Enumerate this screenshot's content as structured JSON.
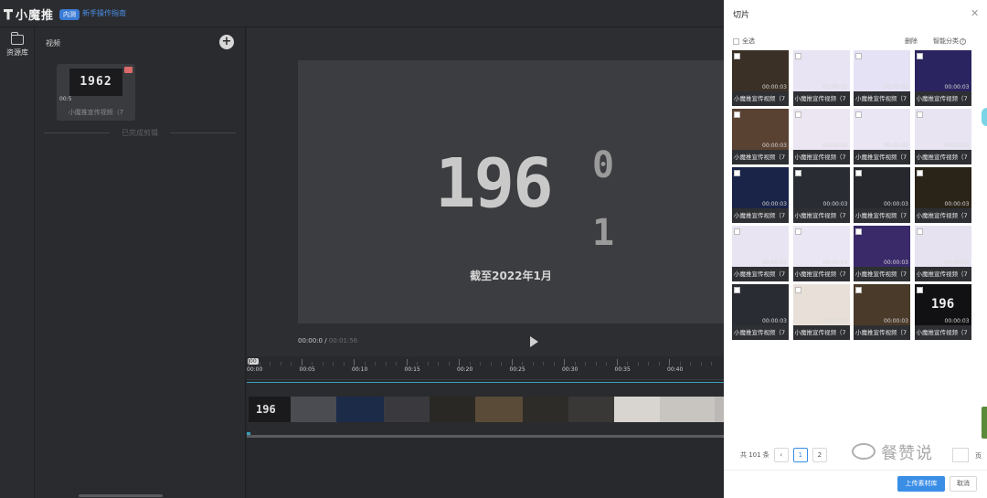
{
  "app": {
    "name": "小魔推",
    "badge": "内测",
    "guide_link": "新手操作指南"
  },
  "rail": {
    "items": [
      {
        "label": "资源库",
        "icon": "folder-icon"
      }
    ]
  },
  "resource_panel": {
    "title": "视频",
    "add_icon": "plus-icon",
    "card": {
      "thumb_text": "1962",
      "duration": "00:5",
      "name": "小魔推宣传视频（7"
    },
    "divider": "已完成剪辑"
  },
  "preview": {
    "big_number": "196",
    "roll_top": "0",
    "roll_bottom": "1",
    "caption": "截至2022年1月",
    "current_time": "00:00:0",
    "separator": " / ",
    "total_time": "00:01:56",
    "play_icon": "play-icon"
  },
  "timeline": {
    "playhead": "00",
    "ticks": [
      "00:00",
      "00:05",
      "00:10",
      "00:15",
      "00:20",
      "00:25",
      "00:30",
      "00:35",
      "00:40"
    ],
    "strip_colors": [
      "#1a1a1c",
      "#4a4c52",
      "#1c2b48",
      "#3a3a3e",
      "#2a2824",
      "#5a4a38",
      "#2e2c28",
      "#3a3836",
      "#d8d4d0",
      "#c8c4c0",
      "#bcb8b6"
    ],
    "strip_label": "196"
  },
  "panel": {
    "title": "切片",
    "close_icon": "close-icon",
    "select_all": "全选",
    "delete": "删除",
    "smart_sort": "智能分类",
    "help_icon": "question-icon",
    "clips": [
      {
        "name": "小魔推宣传视频（7",
        "duration": "00:00:03",
        "thumb": "#3a3026"
      },
      {
        "name": "小魔推宣传视频（7",
        "duration": "00:00:02",
        "thumb": "#e8e4f4"
      },
      {
        "name": "小魔推宣传视频（7",
        "duration": "00:00:02",
        "thumb": "#e6e2f6"
      },
      {
        "name": "小魔推宣传视频（7",
        "duration": "00:00:03",
        "thumb": "#2a2460"
      },
      {
        "name": "小魔推宣传视频（7",
        "duration": "00:00:03",
        "thumb": "#5a4232"
      },
      {
        "name": "小魔推宣传视频（7",
        "duration": "00:00:02",
        "thumb": "#ece6f2"
      },
      {
        "name": "小魔推宣传视频（7",
        "duration": "00:00:02",
        "thumb": "#eae6f4"
      },
      {
        "name": "小魔推宣传视频（7",
        "duration": "00:00:03",
        "thumb": "#e8e4f2"
      },
      {
        "name": "小魔推宣传视频（7",
        "duration": "00:00:03",
        "thumb": "#1a2448"
      },
      {
        "name": "小魔推宣传视频（7",
        "duration": "00:00:03",
        "thumb": "#2a2c34"
      },
      {
        "name": "小魔推宣传视频（7",
        "duration": "00:00:03",
        "thumb": "#26282e"
      },
      {
        "name": "小魔推宣传视频（7",
        "duration": "00:00:03",
        "thumb": "#2a2418"
      },
      {
        "name": "小魔推宣传视频（7",
        "duration": "00:00:03",
        "thumb": "#e8e4f2"
      },
      {
        "name": "小魔推宣传视频（7",
        "duration": "00:00:03",
        "thumb": "#eae6f4"
      },
      {
        "name": "小魔推宣传视频（7",
        "duration": "00:00:03",
        "thumb": "#3a2a6a"
      },
      {
        "name": "小魔推宣传视频（7",
        "duration": "00:00:03",
        "thumb": "#e6e2f0"
      },
      {
        "name": "小魔推宣传视频（7",
        "duration": "00:00:03",
        "thumb": "#2a2c34"
      },
      {
        "name": "小魔推宣传视频（7",
        "duration": "00:00:03",
        "thumb": "#e8e0d8"
      },
      {
        "name": "小魔推宣传视频（7",
        "duration": "00:00:03",
        "thumb": "#4a3a2a"
      },
      {
        "name": "小魔推宣传视频（7",
        "duration": "00:00:03",
        "thumb": "#111113",
        "text": "196"
      }
    ],
    "pager": {
      "total": "共 101 条",
      "pages": [
        "1",
        "2"
      ],
      "current": "1",
      "suffix": "页"
    },
    "watermark": "餐赞说",
    "upload_button": "上传素材库",
    "cancel_button": "取消"
  },
  "colors": {
    "accent": "#3a8ee6",
    "dark_bg": "#26272b",
    "panel_bg": "#ffffff"
  }
}
